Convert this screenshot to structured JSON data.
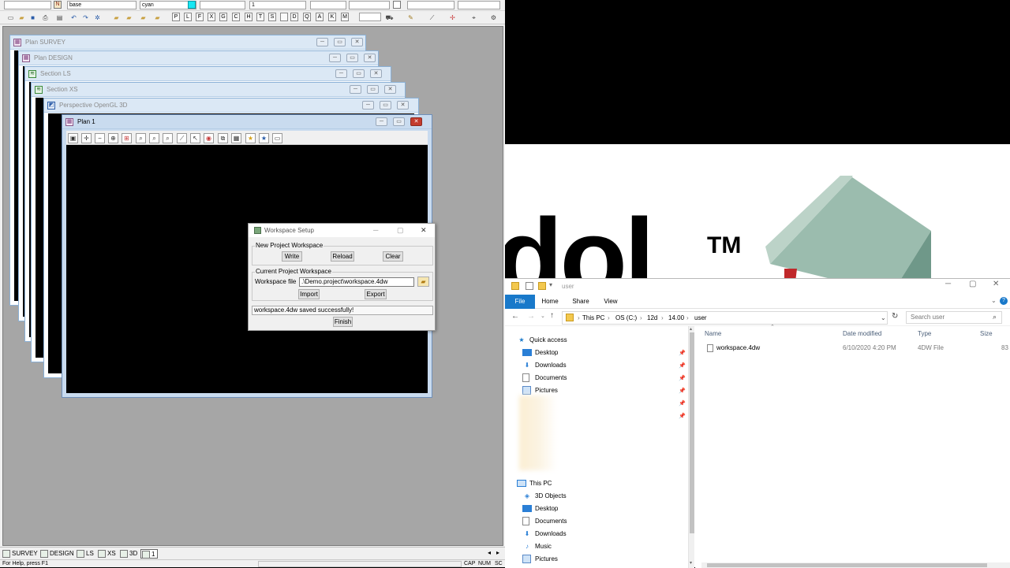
{
  "app": {
    "toolbar1": {
      "combo1_value": "",
      "combo2_value": "base",
      "combo3_value": "cyan",
      "combo4_value": "",
      "combo5_value": "1",
      "colour_swatch": "#17e7f3"
    },
    "toolbar2": {
      "letter_buttons": [
        "P",
        "L",
        "F",
        "X",
        "G",
        "C",
        "H",
        "T",
        "S",
        "",
        "D",
        "Q",
        "A",
        "K",
        "M"
      ]
    },
    "windows": [
      {
        "title": "Plan SURVEY"
      },
      {
        "title": "Plan DESIGN"
      },
      {
        "title": "Section LS"
      },
      {
        "title": "Section XS"
      },
      {
        "title": "Perspective OpenGL 3D"
      },
      {
        "title": "Plan 1"
      }
    ],
    "dialog": {
      "title": "Workspace Setup",
      "new_group": "New Project Workspace",
      "write": "Write",
      "reload": "Reload",
      "clear": "Clear",
      "current_group": "Current Project Workspace",
      "file_label": "Workspace file",
      "file_value": ".\\Demo.project\\workspace.4dw",
      "import": "Import",
      "export": "Export",
      "message": "workspace.4dw saved successfully!",
      "finish": "Finish"
    },
    "taskbar": [
      "SURVEY",
      "DESIGN",
      "LS",
      "XS",
      "3D",
      "1"
    ],
    "status_help": "For Help, press F1",
    "status_caps": "CAP",
    "status_num": "NUM",
    "status_scrl": "SC"
  },
  "splash": {
    "brand_fragment": "dol",
    "tm": "TM"
  },
  "explorer": {
    "title": "user",
    "ribbon": {
      "file": "File",
      "home": "Home",
      "share": "Share",
      "view": "View"
    },
    "breadcrumb": [
      "This PC",
      "OS (C:)",
      "12d",
      "14.00",
      "user"
    ],
    "search_placeholder": "Search user",
    "nav": {
      "quick_access": "Quick access",
      "quick_items": [
        "Desktop",
        "Downloads",
        "Documents",
        "Pictures"
      ],
      "this_pc": "This PC",
      "pc_items": [
        "3D Objects",
        "Desktop",
        "Documents",
        "Downloads",
        "Music",
        "Pictures"
      ]
    },
    "columns": {
      "name": "Name",
      "date": "Date modified",
      "type": "Type",
      "size": "Size"
    },
    "files": [
      {
        "name": "workspace.4dw",
        "date": "6/10/2020 4:20 PM",
        "type": "4DW File",
        "size": "83"
      }
    ],
    "accent": "#1979ca"
  }
}
